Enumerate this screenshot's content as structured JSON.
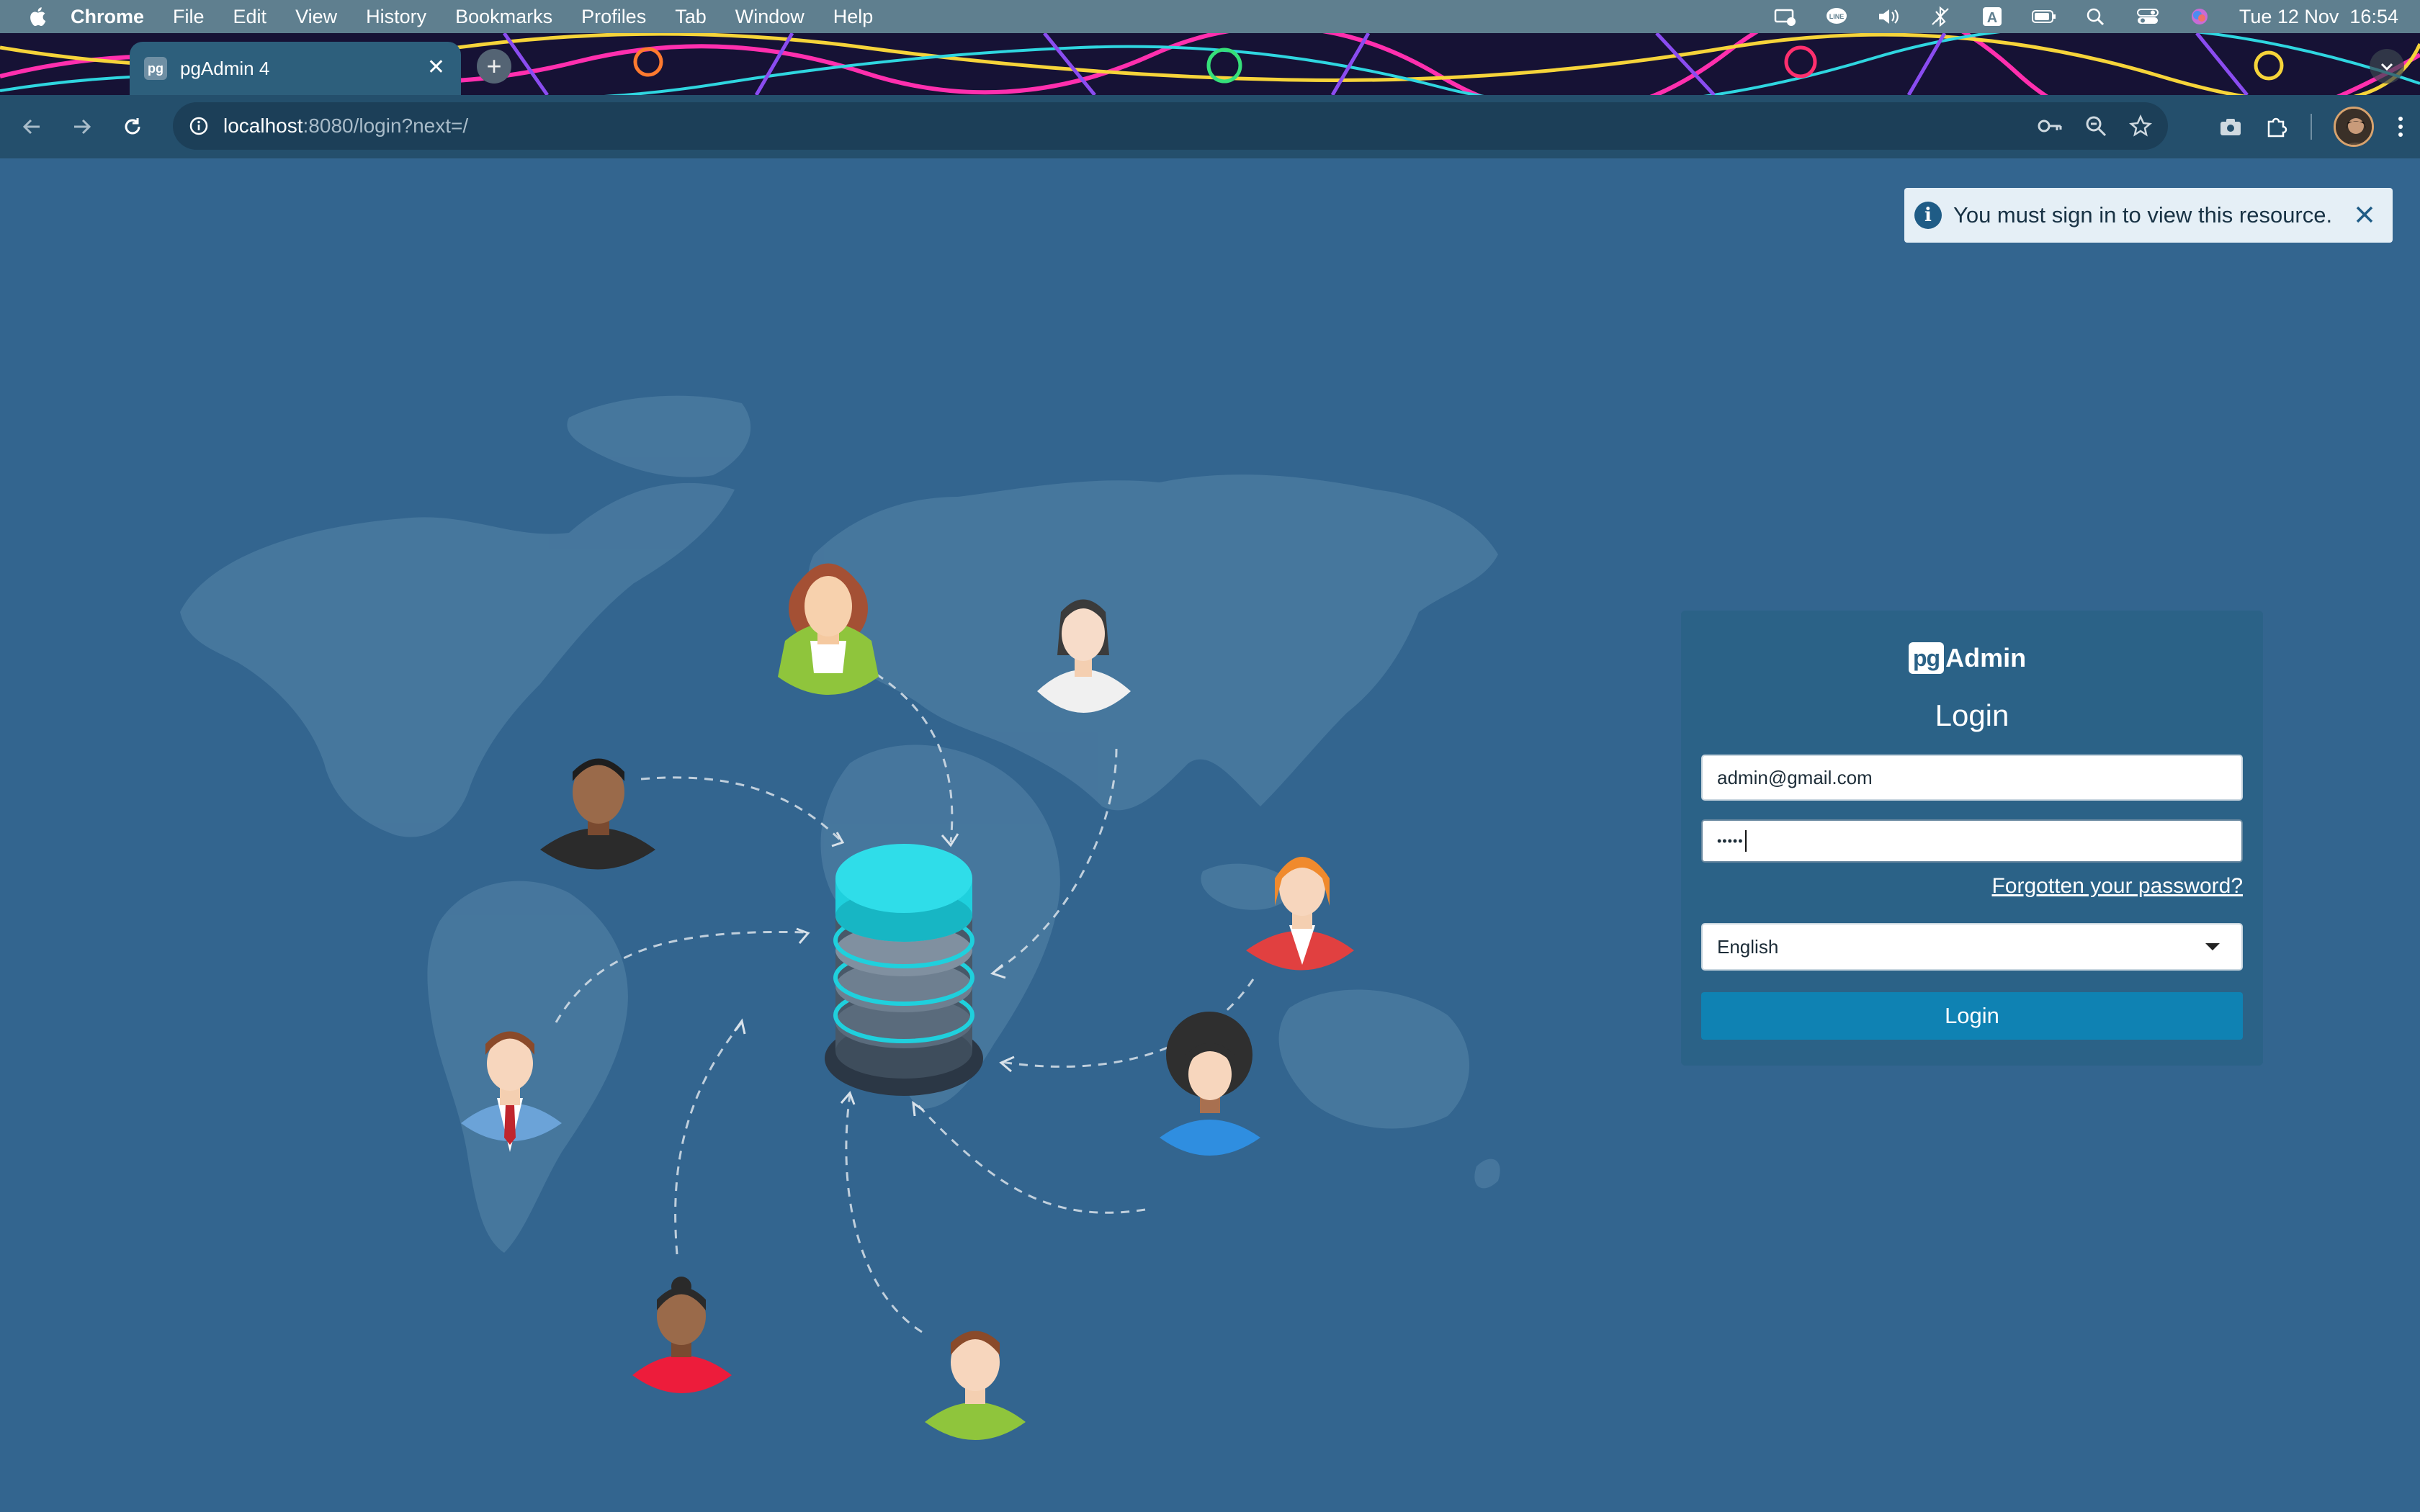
{
  "menubar": {
    "items": [
      "Chrome",
      "File",
      "Edit",
      "View",
      "History",
      "Bookmarks",
      "Profiles",
      "Tab",
      "Window",
      "Help"
    ],
    "clock": "Tue 12 Nov  16:54",
    "status_icons": [
      "display-icon",
      "line-icon",
      "volume-icon",
      "bluetooth-icon",
      "input-source-icon",
      "battery-icon",
      "spotlight-icon",
      "control-center-icon",
      "siri-icon"
    ]
  },
  "browser": {
    "tab_title": "pgAdmin 4",
    "favicon_text": "pg",
    "url_host": "localhost",
    "url_rest": ":8080/login?next=/"
  },
  "toast": {
    "message": "You must sign in to view this resource."
  },
  "login": {
    "logo_pg": "pg",
    "logo_admin": "Admin",
    "title": "Login",
    "email_value": "admin@gmail.com",
    "password_mask": "•••••",
    "forgot_label": "Forgotten your password?",
    "language_selected": "English",
    "button_label": "Login"
  },
  "colors": {
    "background": "#33658f",
    "panel": "#2b6287",
    "login_button": "#0f82b3",
    "database_top": "#1fd0dd"
  }
}
